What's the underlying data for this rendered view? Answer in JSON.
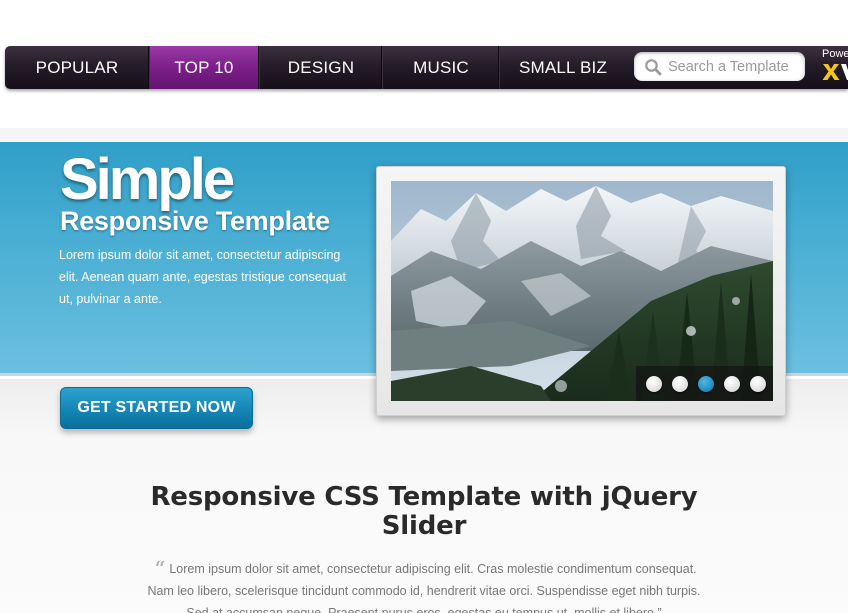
{
  "nav": {
    "items": [
      {
        "label": "POPULAR",
        "active": false
      },
      {
        "label": "TOP 10",
        "active": true
      },
      {
        "label": "DESIGN",
        "active": false
      },
      {
        "label": "MUSIC",
        "active": false
      },
      {
        "label": "SMALL BIZ",
        "active": false
      }
    ],
    "active_color": "#7c1f88",
    "bar_color": "#251c29"
  },
  "search": {
    "placeholder": "Search a Template",
    "icon": "search-icon"
  },
  "powered_by": {
    "label": "Powe",
    "logo_text": "XV"
  },
  "hero": {
    "title": "Simple",
    "subtitle": "Responsive Template",
    "text": "Lorem ipsum dolor sit amet, consectetur adipiscing elit. Aenean quam ante, egestas tristique consequat ut, pulvinar a ante.",
    "cta_label": "GET STARTED NOW",
    "background_color": "#45acd2"
  },
  "slider": {
    "image": "snowy-mountain-valley-photo",
    "dots": [
      false,
      false,
      true,
      false,
      false
    ],
    "active_dot_color": "#1585c0"
  },
  "content": {
    "heading": "Responsive CSS Template with jQuery Slider",
    "quote_mark": "“",
    "paragraph": "Lorem ipsum dolor sit amet, consectetur adipiscing elit. Cras molestie condimentum consequat. Nam leo libero, scelerisque tincidunt commodo id, hendrerit vitae orci. Suspendisse eget nibh turpis. Sed at accumsan neque. Praesent purus eros, egestas eu tempus ut, mollis et libero.”"
  }
}
